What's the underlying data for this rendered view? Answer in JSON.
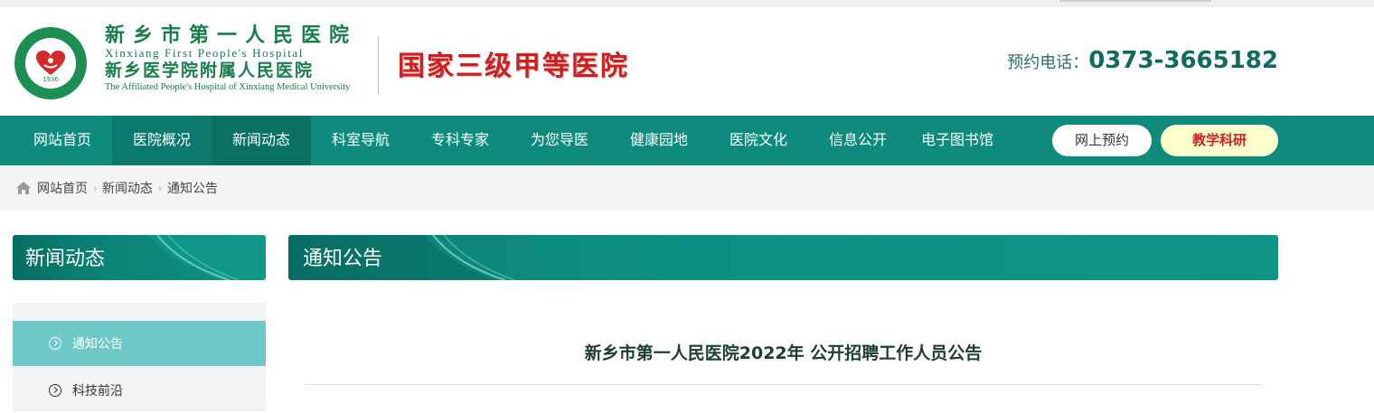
{
  "header": {
    "logo": {
      "cn_name": "新乡市第一人民医院",
      "en_name": "Xinxiang First People's Hospital",
      "cn_affiliate": "新乡医学院附属人民医院",
      "en_affiliate": "The Affiliated People's Hospital of Xinxiang Medical University",
      "badge_year": "1936"
    },
    "grade": "国家三级甲等医院",
    "phone_label": "预约电话：",
    "phone_number": "0373-3665182"
  },
  "nav": {
    "items": [
      {
        "label": "网站首页"
      },
      {
        "label": "医院概况"
      },
      {
        "label": "新闻动态"
      },
      {
        "label": "科室导航"
      },
      {
        "label": "专科专家"
      },
      {
        "label": "为您导医"
      },
      {
        "label": "健康园地"
      },
      {
        "label": "医院文化"
      },
      {
        "label": "信息公开"
      },
      {
        "label": "电子图书馆"
      }
    ],
    "active": "新闻动态",
    "appointment_button": "网上预约",
    "teaching_button": "教学科研"
  },
  "breadcrumb": {
    "items": [
      "网站首页",
      "新闻动态",
      "通知公告"
    ]
  },
  "sidebar": {
    "title": "新闻动态",
    "items": [
      {
        "label": "通知公告",
        "active": true
      },
      {
        "label": "科技前沿",
        "active": false
      }
    ]
  },
  "main": {
    "title": "通知公告",
    "article_title": "新乡市第一人民医院2022年 公开招聘工作人员公告"
  },
  "colors": {
    "brand_teal": "#0e8b7c",
    "nav_active": "#087163",
    "sidebar_active": "#6ec9c6",
    "grade_red": "#cc1f1f",
    "logo_green": "#177e4a"
  }
}
